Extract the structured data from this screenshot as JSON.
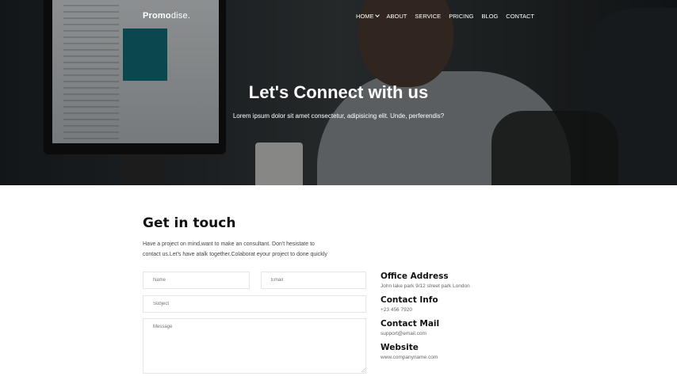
{
  "brand": {
    "bold": "Promo",
    "rest": "dise."
  },
  "nav": {
    "items": [
      "HOME",
      "ABOUT",
      "SERVICE",
      "PRICING",
      "BLOG",
      "CONTACT"
    ]
  },
  "hero": {
    "title": "Let's Connect with us",
    "subtitle": "Lorem ipsum dolor sit amet consectetur, adipisicing elit. Unde, perferendis?"
  },
  "contact": {
    "title": "Get in touch",
    "description_line1": "Have a project on mind,want to make an consultant. Don't hesistate to",
    "description_line2": "contact us.Let's have atalk together.Colaborat eyour project to done quickly"
  },
  "form": {
    "name_placeholder": "Name",
    "email_placeholder": "Email",
    "subject_placeholder": "Subject",
    "message_placeholder": "Message"
  },
  "info": {
    "office_title": "Office Address",
    "office_value": "John lake park 9/12 street park London",
    "phone_title": "Contact Info",
    "phone_value": "+23 456 7920",
    "mail_title": "Contact Mail",
    "mail_value": "support@email.com",
    "web_title": "Website",
    "web_value": "www.companyname.com"
  }
}
